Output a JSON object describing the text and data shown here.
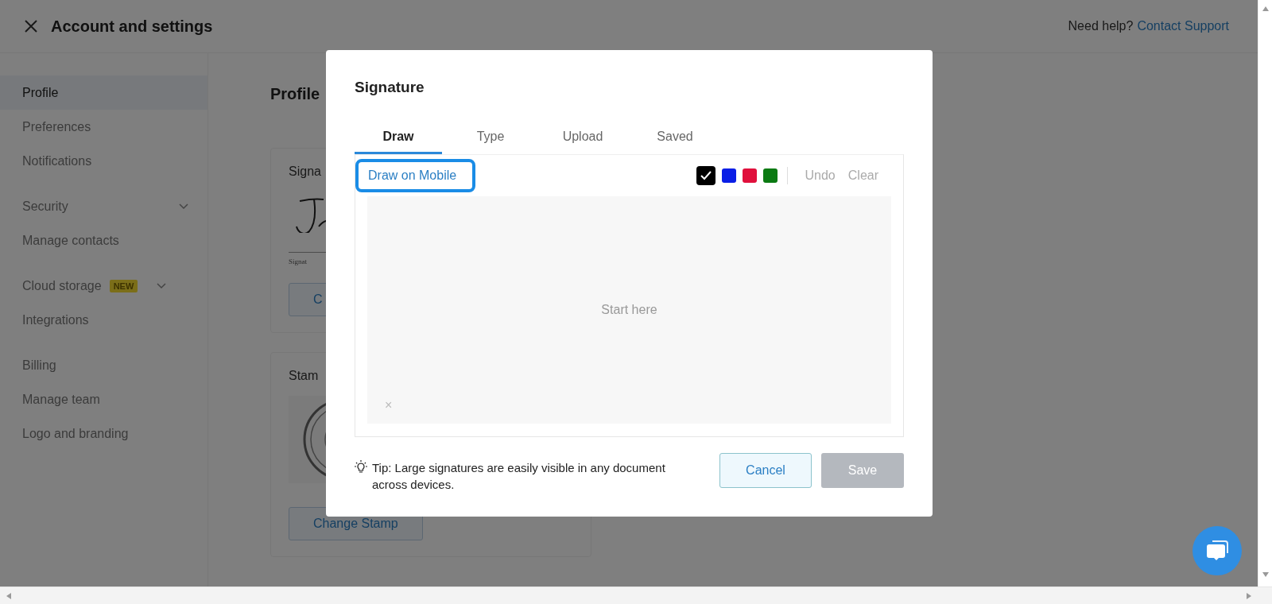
{
  "header": {
    "title": "Account and settings",
    "help_text": "Need help?",
    "help_link": "Contact Support"
  },
  "sidebar": {
    "groups": [
      [
        {
          "label": "Profile",
          "selected": true
        },
        {
          "label": "Preferences",
          "selected": false
        },
        {
          "label": "Notifications",
          "selected": false
        }
      ],
      [
        {
          "label": "Security",
          "selected": false,
          "expandable": true
        },
        {
          "label": "Manage contacts",
          "selected": false
        }
      ],
      [
        {
          "label": "Cloud storage",
          "selected": false,
          "expandable": true,
          "badge": "NEW"
        },
        {
          "label": "Integrations",
          "selected": false
        }
      ],
      [
        {
          "label": "Billing",
          "selected": false
        },
        {
          "label": "Manage team",
          "selected": false
        },
        {
          "label": "Logo and branding",
          "selected": false
        }
      ]
    ]
  },
  "content": {
    "heading": "Profile",
    "signature_card": {
      "label": "Signa",
      "caption": "Signat",
      "button": "C"
    },
    "stamp_card": {
      "label": "Stam",
      "button": "Change Stamp"
    }
  },
  "dialog": {
    "title": "Signature",
    "tabs": [
      {
        "label": "Draw",
        "selected": true
      },
      {
        "label": "Type",
        "selected": false
      },
      {
        "label": "Upload",
        "selected": false
      },
      {
        "label": "Saved",
        "selected": false
      }
    ],
    "mobile_link": "Draw on Mobile",
    "mobile_link_highlighted": true,
    "colors": [
      {
        "color": "#000000",
        "selected": true
      },
      {
        "color": "#0a1ee6",
        "selected": false
      },
      {
        "color": "#e0103c",
        "selected": false
      },
      {
        "color": "#0b7a12",
        "selected": false
      }
    ],
    "undo": {
      "label": "Undo",
      "disabled": true
    },
    "clear": {
      "label": "Clear",
      "disabled": true
    },
    "canvas_hint": "Start here",
    "clear_mark": "×",
    "tip": "Tip: Large signatures are easily visible in any document across devices.",
    "buttons": [
      {
        "label": "Cancel",
        "kind": "secondary",
        "disabled": false
      },
      {
        "label": "Save",
        "kind": "primary",
        "disabled": true
      }
    ]
  }
}
